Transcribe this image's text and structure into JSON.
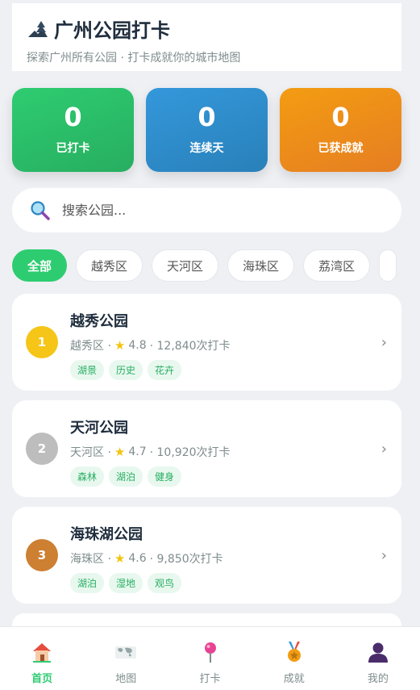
{
  "header": {
    "title": "广州公园打卡",
    "subtitle": "探索广州所有公园 · 打卡成就你的城市地图",
    "icon": "park-tree-icon"
  },
  "stats": [
    {
      "value": "0",
      "label": "已打卡",
      "color": "#2ecc71"
    },
    {
      "value": "0",
      "label": "连续天",
      "color": "#3498db"
    },
    {
      "value": "0",
      "label": "已获成就",
      "color": "#f39c12"
    }
  ],
  "search": {
    "placeholder": "搜索公园..."
  },
  "filters": [
    "全部",
    "越秀区",
    "天河区",
    "海珠区",
    "荔湾区"
  ],
  "parks": [
    {
      "rank": "1",
      "rank_color": "#f5c518",
      "name": "越秀公园",
      "district": "越秀区 ·",
      "rating": "4.8",
      "checkins": "· 12,840次打卡",
      "tags": [
        "湖景",
        "历史",
        "花卉"
      ]
    },
    {
      "rank": "2",
      "rank_color": "#bdbdbd",
      "name": "天河公园",
      "district": "天河区 ·",
      "rating": "4.7",
      "checkins": "· 10,920次打卡",
      "tags": [
        "森林",
        "湖泊",
        "健身"
      ]
    },
    {
      "rank": "3",
      "rank_color": "#cd7f32",
      "name": "海珠湖公园",
      "district": "海珠区 ·",
      "rating": "4.6",
      "checkins": "· 9,850次打卡",
      "tags": [
        "湖泊",
        "湿地",
        "观鸟"
      ]
    }
  ],
  "tabs": [
    {
      "label": "首页",
      "icon": "home-icon",
      "active": true
    },
    {
      "label": "地图",
      "icon": "world-map-icon",
      "active": false
    },
    {
      "label": "打卡",
      "icon": "pin-icon",
      "active": false
    },
    {
      "label": "成就",
      "icon": "medal-icon",
      "active": false
    },
    {
      "label": "我的",
      "icon": "user-icon",
      "active": false
    }
  ],
  "colors": {
    "accent": "#2ecc71",
    "text": "#2c3e50",
    "muted": "#7f8c8d"
  }
}
